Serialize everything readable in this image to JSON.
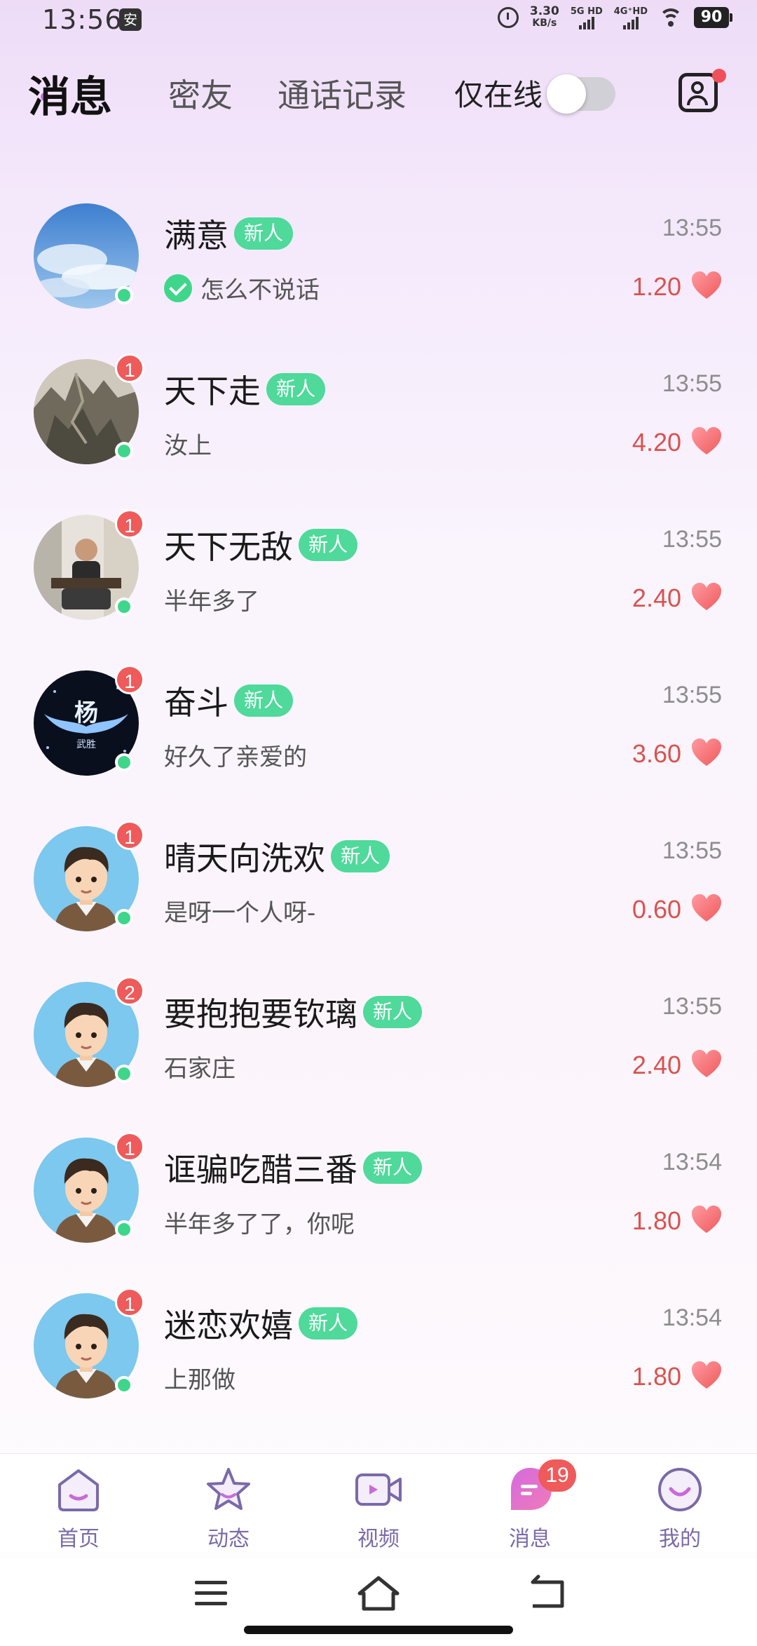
{
  "status_bar": {
    "time": "13:56",
    "app_icon_glyph": "安",
    "net_speed_value": "3.30",
    "net_speed_unit": "KB/s",
    "sim1_label": "5G HD",
    "sim2_label": "4G⁺HD",
    "battery": "90"
  },
  "header": {
    "tabs": [
      {
        "label": "消息",
        "active": true
      },
      {
        "label": "密友",
        "active": false
      },
      {
        "label": "通话记录",
        "active": false
      }
    ],
    "online_only_label": "仅在线",
    "online_only_enabled": false
  },
  "conversations": [
    {
      "name": "满意",
      "tag": "新人",
      "time": "13:55",
      "message": "怎么不说话",
      "verified": true,
      "score": "1.20",
      "unread": "",
      "avatar": "sky"
    },
    {
      "name": "天下走",
      "tag": "新人",
      "time": "13:55",
      "message": "汝上",
      "verified": false,
      "score": "4.20",
      "unread": "1",
      "avatar": "mountain"
    },
    {
      "name": "天下无敌",
      "tag": "新人",
      "time": "13:55",
      "message": "半年多了",
      "verified": false,
      "score": "2.40",
      "unread": "1",
      "avatar": "man-photo"
    },
    {
      "name": "奋斗",
      "tag": "新人",
      "time": "13:55",
      "message": "好久了亲爱的",
      "verified": false,
      "score": "3.60",
      "unread": "1",
      "avatar": "wings-logo",
      "avatar_text": "杨",
      "avatar_subtext": "武胜"
    },
    {
      "name": "晴天向洗欢",
      "tag": "新人",
      "time": "13:55",
      "message": "是呀一个人呀-",
      "verified": false,
      "score": "0.60",
      "unread": "1",
      "avatar": "cartoon-boy"
    },
    {
      "name": "要抱抱要钦璃",
      "tag": "新人",
      "time": "13:55",
      "message": "石家庄",
      "verified": false,
      "score": "2.40",
      "unread": "2",
      "avatar": "cartoon-boy"
    },
    {
      "name": "诓骗吃醋三番",
      "tag": "新人",
      "time": "13:54",
      "message": "半年多了了，你呢",
      "verified": false,
      "score": "1.80",
      "unread": "1",
      "avatar": "cartoon-boy"
    },
    {
      "name": "迷恋欢嬉",
      "tag": "新人",
      "time": "13:54",
      "message": "上那做",
      "verified": false,
      "score": "1.80",
      "unread": "1",
      "avatar": "cartoon-boy"
    }
  ],
  "bottom_nav": [
    {
      "label": "首页",
      "icon": "home-icon"
    },
    {
      "label": "动态",
      "icon": "star-icon"
    },
    {
      "label": "视频",
      "icon": "video-icon"
    },
    {
      "label": "消息",
      "icon": "message-icon",
      "badge": "19",
      "active": true
    },
    {
      "label": "我的",
      "icon": "profile-icon"
    }
  ],
  "colors": {
    "accent": "#c86ad9",
    "new_tag": "#4fd99a",
    "online_dot": "#3ed68b",
    "badge": "#ef5a5a",
    "score": "#d9534f"
  }
}
